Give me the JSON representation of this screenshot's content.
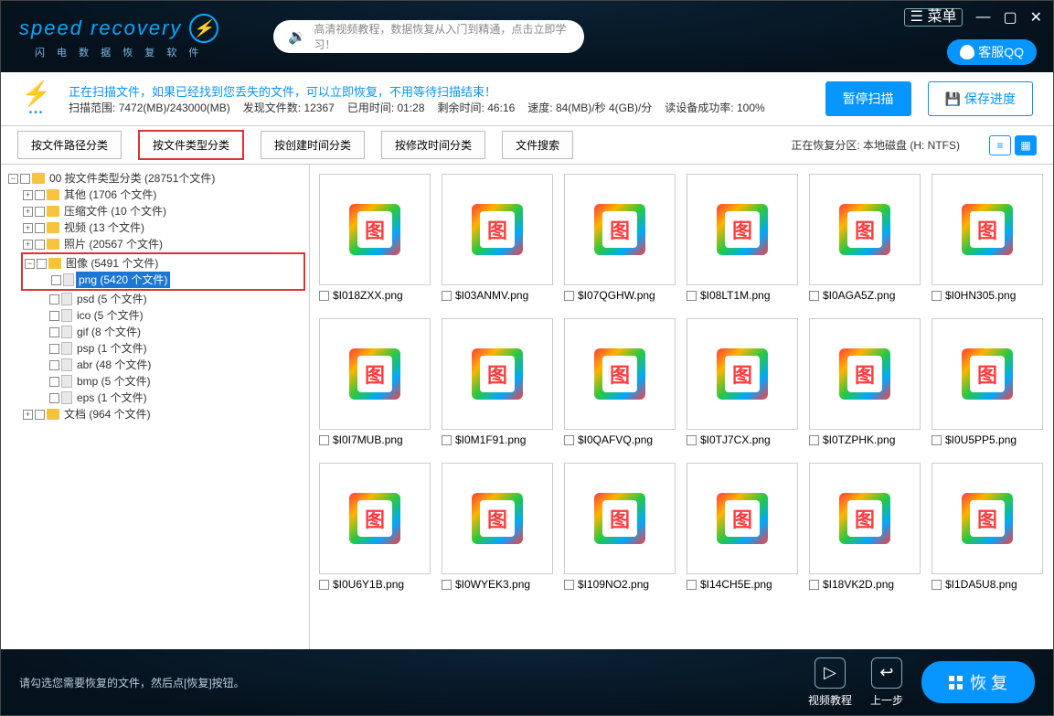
{
  "brand": {
    "name": "speed recovery",
    "tagline": "闪 电 数 据 恢 复 软 件"
  },
  "window": {
    "menu": "菜单"
  },
  "promo": {
    "text": "高清视频教程，数据恢复从入门到精通，点击立即学习！"
  },
  "qq": {
    "label": "客服QQ"
  },
  "status": {
    "line1": "正在扫描文件，如果已经找到您丢失的文件，可以立即恢复，不用等待扫描结束！",
    "range_label": "扫描范围:",
    "range_value": "7472(MB)/243000(MB)",
    "found_label": "发现文件数:",
    "found_value": "12367",
    "elapsed_label": "已用时间:",
    "elapsed_value": "01:28",
    "remain_label": "剩余时间:",
    "remain_value": "46:16",
    "speed_label": "速度:",
    "speed_value": "84(MB)/秒  4(GB)/分",
    "success_label": "读设备成功率:",
    "success_value": "100%",
    "pause": "暂停扫描",
    "save": "保存进度"
  },
  "tabs": {
    "t1": "按文件路径分类",
    "t2": "按文件类型分类",
    "t3": "按创建时间分类",
    "t4": "按修改时间分类",
    "t5": "文件搜索",
    "partition": "正在恢复分区: 本地磁盘 (H: NTFS)"
  },
  "tree": {
    "root": "00 按文件类型分类     (28751个文件)",
    "other": "其他     (1706 个文件)",
    "archive": "压缩文件     (10 个文件)",
    "video": "视频     (13 个文件)",
    "photo": "照片     (20567 个文件)",
    "image": "图像     (5491 个文件)",
    "png": "png     (5420 个文件)",
    "psd": "psd     (5 个文件)",
    "ico": "ico     (5 个文件)",
    "gif": "gif     (8 个文件)",
    "psp": "psp     (1 个文件)",
    "abr": "abr     (48 个文件)",
    "bmp": "bmp     (5 个文件)",
    "eps": "eps     (1 个文件)",
    "doc": "文档     (964 个文件)"
  },
  "files": [
    "$I018ZXX.png",
    "$I03ANMV.png",
    "$I07QGHW.png",
    "$I08LT1M.png",
    "$I0AGA5Z.png",
    "$I0HN305.png",
    "$I0I7MUB.png",
    "$I0M1F91.png",
    "$I0QAFVQ.png",
    "$I0TJ7CX.png",
    "$I0TZPHK.png",
    "$I0U5PP5.png",
    "$I0U6Y1B.png",
    "$I0WYEK3.png",
    "$I109NO2.png",
    "$I14CH5E.png",
    "$I18VK2D.png",
    "$I1DA5U8.png"
  ],
  "footer": {
    "hint": "请勾选您需要恢复的文件，然后点[恢复]按钮。",
    "video": "视频教程",
    "back": "上一步",
    "recover": "恢 复"
  }
}
